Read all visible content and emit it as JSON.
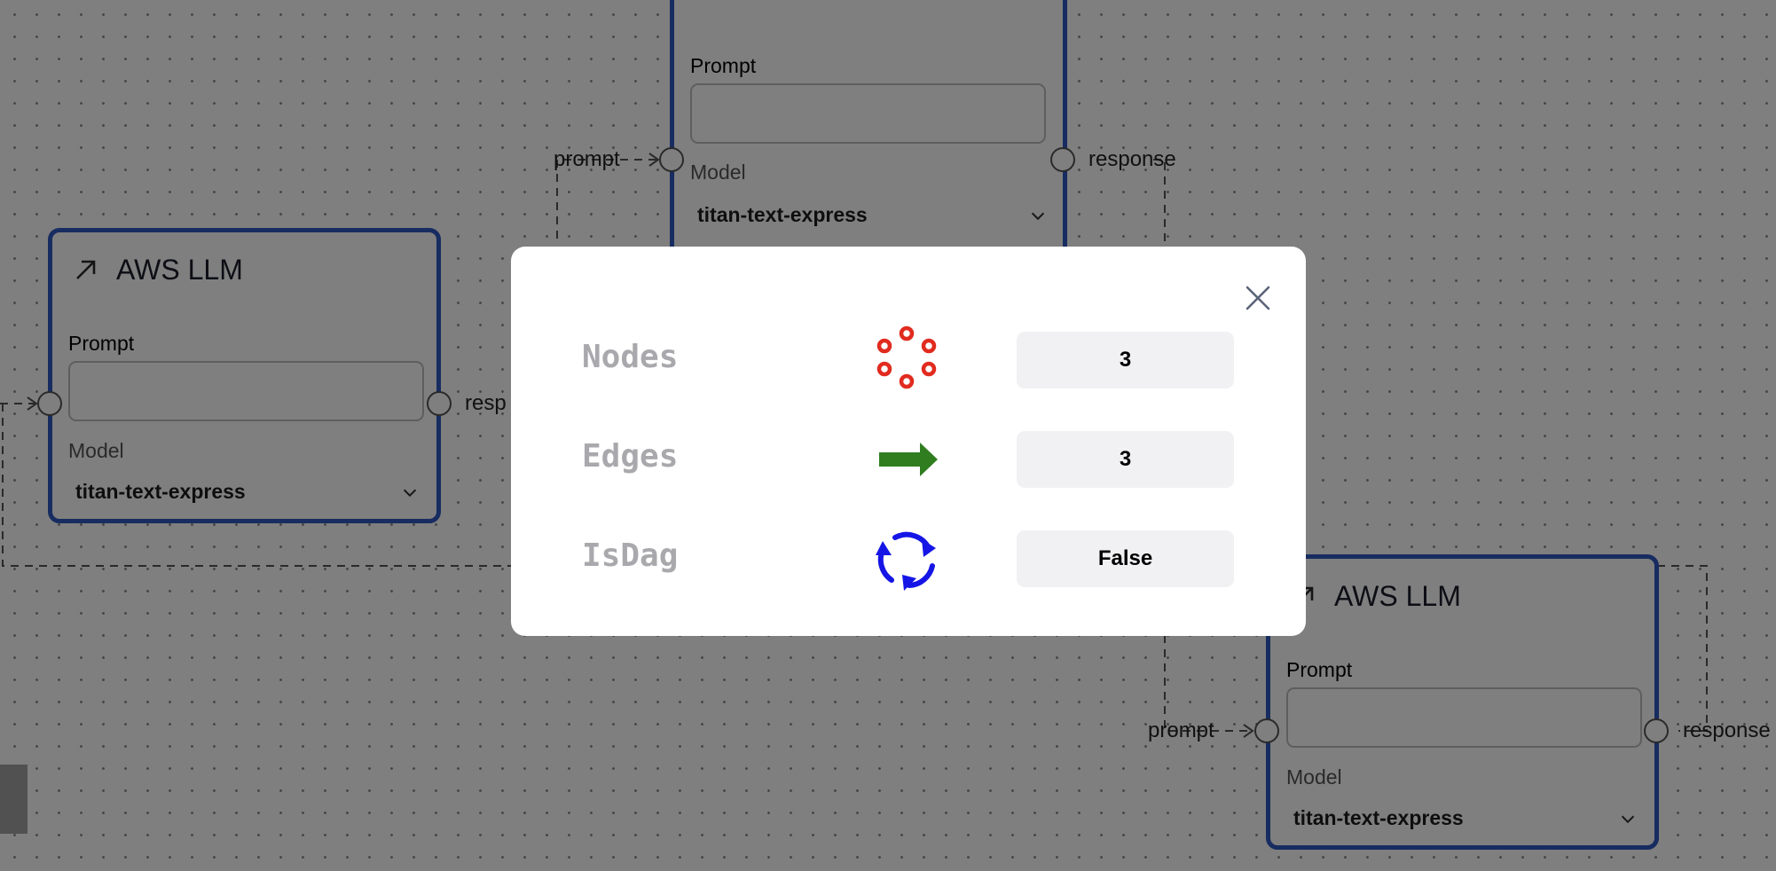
{
  "nodes": [
    {
      "title": "",
      "prompt_label": "Prompt",
      "model_label": "Model",
      "model_value": "titan-text-express",
      "input_port": "prompt",
      "output_port": "response"
    },
    {
      "title": "AWS LLM",
      "prompt_label": "Prompt",
      "model_label": "Model",
      "model_value": "titan-text-express",
      "input_port": "",
      "output_port": "resp"
    },
    {
      "title": "AWS LLM",
      "prompt_label": "Prompt",
      "model_label": "Model",
      "model_value": "titan-text-express",
      "input_port": "prompt",
      "output_port": "response"
    }
  ],
  "modal": {
    "close_icon": "close-icon",
    "stats": [
      {
        "label": "Nodes",
        "icon": "nodes-icon",
        "value": "3",
        "icon_color": "#e12b1f"
      },
      {
        "label": "Edges",
        "icon": "arrow-right-icon",
        "value": "3",
        "icon_color": "#2f7d1f"
      },
      {
        "label": "IsDag",
        "icon": "cycle-icon",
        "value": "False",
        "icon_color": "#1515e6"
      }
    ]
  },
  "colors": {
    "node_border": "#2e59c0",
    "overlay": "rgba(0,0,0,0.5)"
  }
}
